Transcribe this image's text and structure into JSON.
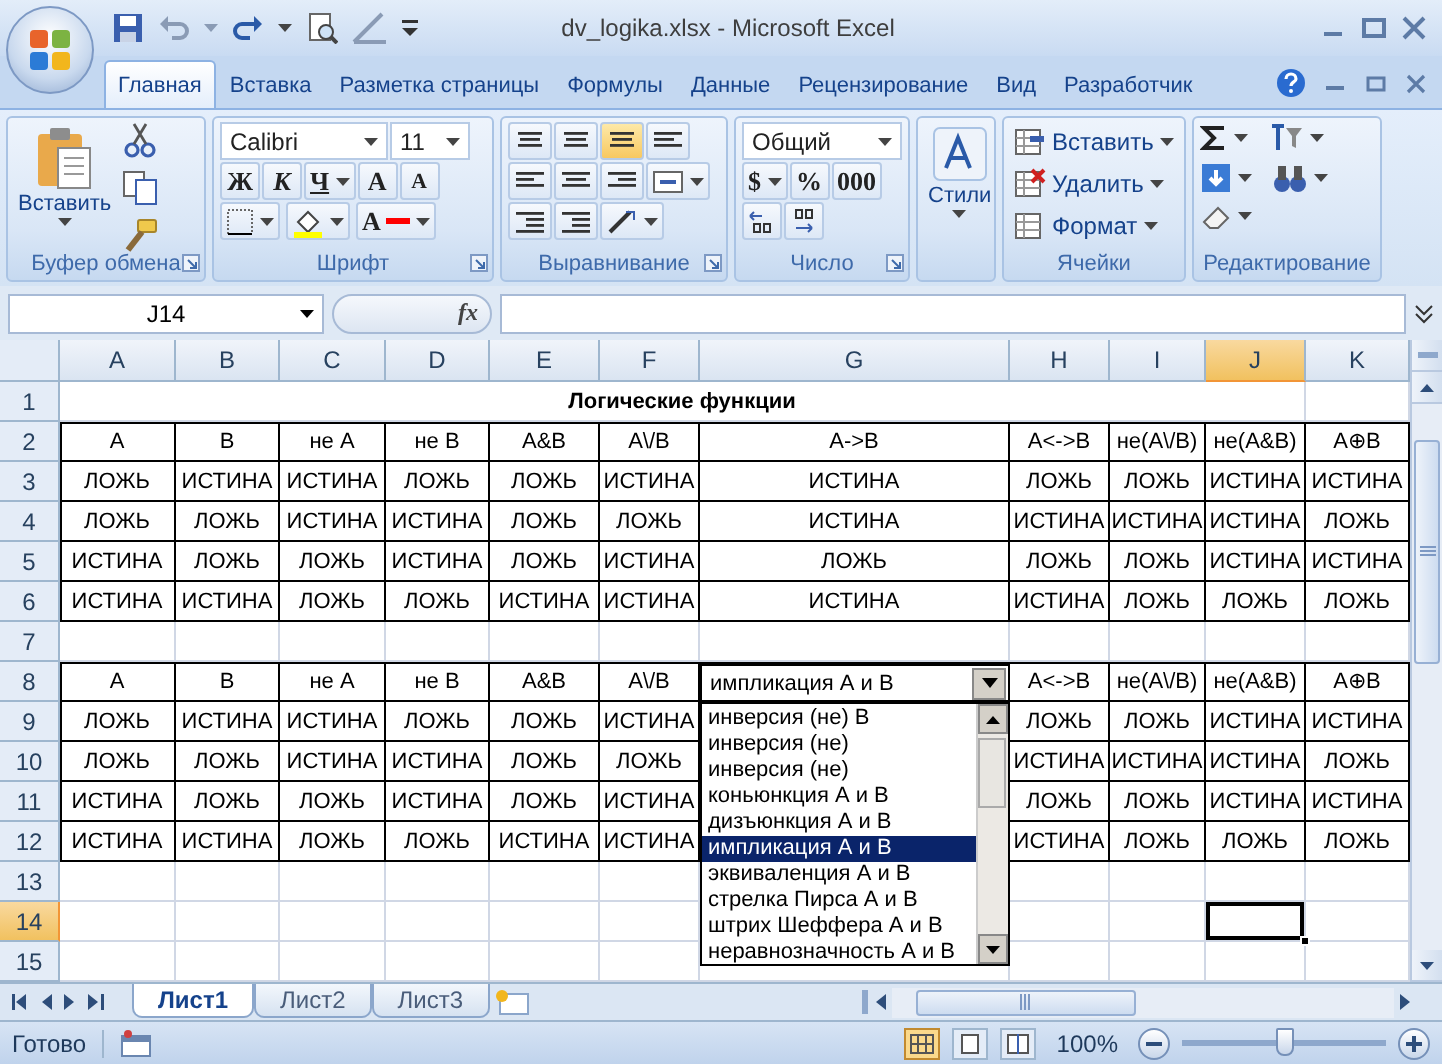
{
  "window": {
    "title": "dv_logika.xlsx - Microsoft Excel"
  },
  "ribbon": {
    "tabs": [
      {
        "label": "Главная",
        "selected": true
      },
      {
        "label": "Вставка",
        "selected": false
      },
      {
        "label": "Разметка страницы",
        "selected": false
      },
      {
        "label": "Формулы",
        "selected": false
      },
      {
        "label": "Данные",
        "selected": false
      },
      {
        "label": "Рецензирование",
        "selected": false
      },
      {
        "label": "Вид",
        "selected": false
      },
      {
        "label": "Разработчик",
        "selected": false
      }
    ],
    "clipboard": {
      "paste": "Вставить",
      "label": "Буфер обмена"
    },
    "font": {
      "name": "Calibri",
      "size": "11",
      "bold": "Ж",
      "italic": "К",
      "underline": "Ч",
      "grow": "A",
      "shrink": "A",
      "color_letter": "A",
      "label": "Шрифт"
    },
    "alignment": {
      "label": "Выравнивание"
    },
    "number": {
      "format": "Общий",
      "currency": "$",
      "percent": "%",
      "thousands": "000",
      "label": "Число"
    },
    "styles": {
      "label": "Стили"
    },
    "cells": {
      "buttons": [
        "Вставить",
        "Удалить",
        "Формат"
      ],
      "label": "Ячейки"
    },
    "editing": {
      "label": "Редактирование"
    }
  },
  "formula_bar": {
    "name_box": "J14",
    "fx": "fx"
  },
  "columns": [
    {
      "letter": "A",
      "selected": false
    },
    {
      "letter": "B",
      "selected": false
    },
    {
      "letter": "C",
      "selected": false
    },
    {
      "letter": "D",
      "selected": false
    },
    {
      "letter": "E",
      "selected": false
    },
    {
      "letter": "F",
      "selected": false
    },
    {
      "letter": "G",
      "selected": false
    },
    {
      "letter": "H",
      "selected": false
    },
    {
      "letter": "I",
      "selected": false
    },
    {
      "letter": "J",
      "selected": true
    },
    {
      "letter": "K",
      "selected": false
    }
  ],
  "rows": [
    {
      "label": "1",
      "selected": false
    },
    {
      "label": "2",
      "selected": false
    },
    {
      "label": "3",
      "selected": false
    },
    {
      "label": "4",
      "selected": false
    },
    {
      "label": "5",
      "selected": false
    },
    {
      "label": "6",
      "selected": false
    },
    {
      "label": "7",
      "selected": false
    },
    {
      "label": "8",
      "selected": false
    },
    {
      "label": "9",
      "selected": false
    },
    {
      "label": "10",
      "selected": false
    },
    {
      "label": "11",
      "selected": false
    },
    {
      "label": "12",
      "selected": false
    },
    {
      "label": "13",
      "selected": false
    },
    {
      "label": "14",
      "selected": true
    },
    {
      "label": "15",
      "selected": false
    }
  ],
  "title": "Логические функции",
  "table1": {
    "header": [
      "A",
      "B",
      "не A",
      "не B",
      "A&B",
      "A\\/B",
      "A->B",
      "A<->B",
      "не(A\\/B)",
      "не(A&B)",
      "A⊕B"
    ],
    "rows": [
      [
        "ЛОЖЬ",
        "ИСТИНА",
        "ИСТИНА",
        "ЛОЖЬ",
        "ЛОЖЬ",
        "ИСТИНА",
        "ИСТИНА",
        "ЛОЖЬ",
        "ЛОЖЬ",
        "ИСТИНА",
        "ИСТИНА"
      ],
      [
        "ЛОЖЬ",
        "ЛОЖЬ",
        "ИСТИНА",
        "ИСТИНА",
        "ЛОЖЬ",
        "ЛОЖЬ",
        "ИСТИНА",
        "ИСТИНА",
        "ИСТИНА",
        "ИСТИНА",
        "ЛОЖЬ"
      ],
      [
        "ИСТИНА",
        "ЛОЖЬ",
        "ЛОЖЬ",
        "ИСТИНА",
        "ЛОЖЬ",
        "ИСТИНА",
        "ЛОЖЬ",
        "ЛОЖЬ",
        "ЛОЖЬ",
        "ИСТИНА",
        "ИСТИНА"
      ],
      [
        "ИСТИНА",
        "ИСТИНА",
        "ЛОЖЬ",
        "ЛОЖЬ",
        "ИСТИНА",
        "ИСТИНА",
        "ИСТИНА",
        "ИСТИНА",
        "ЛОЖЬ",
        "ЛОЖЬ",
        "ЛОЖЬ"
      ]
    ]
  },
  "table2": {
    "header_left": [
      "A",
      "B",
      "не A",
      "не B",
      "A&B",
      "A\\/B"
    ],
    "header_right": [
      "A<->B",
      "не(A\\/B)",
      "не(A&B)",
      "A⊕B"
    ],
    "rows": [
      {
        "left": [
          "ЛОЖЬ",
          "ИСТИНА",
          "ИСТИНА",
          "ЛОЖЬ",
          "ЛОЖЬ",
          "ИСТИНА"
        ],
        "right": [
          "ЛОЖЬ",
          "ЛОЖЬ",
          "ИСТИНА",
          "ИСТИНА"
        ]
      },
      {
        "left": [
          "ЛОЖЬ",
          "ЛОЖЬ",
          "ИСТИНА",
          "ИСТИНА",
          "ЛОЖЬ",
          "ЛОЖЬ"
        ],
        "right": [
          "ИСТИНА",
          "ИСТИНА",
          "ИСТИНА",
          "ЛОЖЬ"
        ]
      },
      {
        "left": [
          "ИСТИНА",
          "ЛОЖЬ",
          "ЛОЖЬ",
          "ИСТИНА",
          "ЛОЖЬ",
          "ИСТИНА"
        ],
        "right": [
          "ЛОЖЬ",
          "ЛОЖЬ",
          "ИСТИНА",
          "ИСТИНА"
        ]
      },
      {
        "left": [
          "ИСТИНА",
          "ИСТИНА",
          "ЛОЖЬ",
          "ЛОЖЬ",
          "ИСТИНА",
          "ИСТИНА"
        ],
        "right": [
          "ИСТИНА",
          "ЛОЖЬ",
          "ЛОЖЬ",
          "ЛОЖЬ"
        ]
      }
    ]
  },
  "dropdown": {
    "value": "импликация А и В",
    "items": [
      {
        "label": "инверсия (не) В",
        "selected": false
      },
      {
        "label": "инверсия (не)",
        "selected": false
      },
      {
        "label": "инверсия (не)",
        "selected": false
      },
      {
        "label": "коньюнкция А и В",
        "selected": false
      },
      {
        "label": "дизъюнкция А и В",
        "selected": false
      },
      {
        "label": "импликация А и В",
        "selected": true
      },
      {
        "label": "эквиваленция А и В",
        "selected": false
      },
      {
        "label": "стрелка Пирса А и В",
        "selected": false
      },
      {
        "label": "штрих Шеффера А и В",
        "selected": false
      },
      {
        "label": "неравнозначность А и В",
        "selected": false
      }
    ]
  },
  "sheet_tabs": [
    {
      "label": "Лист1",
      "selected": true
    },
    {
      "label": "Лист2",
      "selected": false
    },
    {
      "label": "Лист3",
      "selected": false
    }
  ],
  "status_bar": {
    "status": "Готово",
    "zoom": "100%",
    "zoom_slider": {
      "level": 0.5
    }
  }
}
